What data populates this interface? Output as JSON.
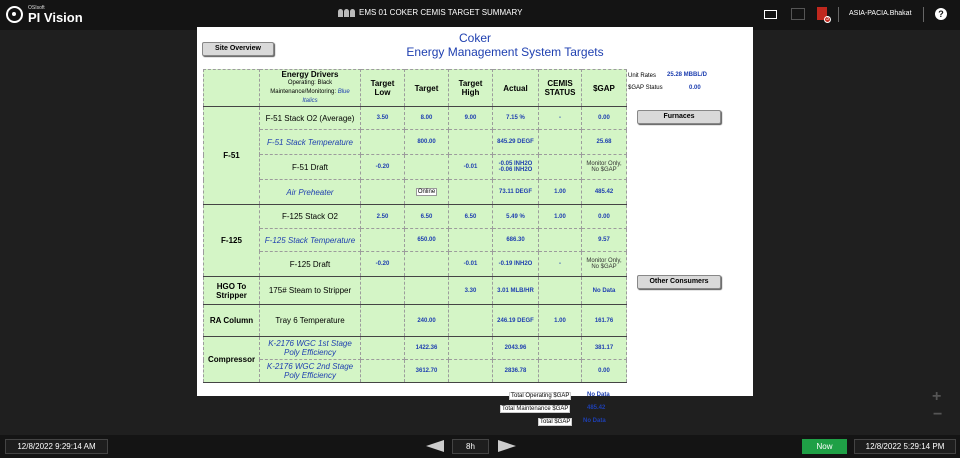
{
  "app": {
    "vendor": "OSIsoft",
    "name": "PI Vision"
  },
  "display": {
    "title": "EMS 01 COKER CEMIS TARGET SUMMARY"
  },
  "user": {
    "name": "ASIA-PACIA.Bhakat",
    "alert_count": "3"
  },
  "header": {
    "line1": "Coker",
    "line2": "Energy Management System Targets"
  },
  "buttons": {
    "site_overview": "Site Overview",
    "furnaces": "Furnaces",
    "other_consumers": "Other Consumers"
  },
  "side_info": {
    "unit_rates_label": "Unit Rates",
    "unit_rates_value": "25.28 MBBL/D",
    "gap_status_label": "$GAP Status",
    "gap_status_value": "0.00"
  },
  "table": {
    "headers": {
      "drivers": "Energy Drivers",
      "drivers_sub1": "Operating: Black",
      "drivers_sub2": "Maintenance/Monitoring:",
      "drivers_sub3": "Blue Italics",
      "target_low": "Target Low",
      "target": "Target",
      "target_high": "Target High",
      "actual": "Actual",
      "cemis": "CEMIS STATUS",
      "gap": "$GAP"
    },
    "groups": [
      {
        "name": "F-51",
        "rows": [
          {
            "driver": "F-51 Stack O2 (Average)",
            "low": "3.50",
            "target": "8.00",
            "high": "9.00",
            "actual": "7.15 %",
            "status": "-",
            "gap": "0.00"
          },
          {
            "driver": "F-51 Stack Temperature",
            "low": "",
            "target": "800.00",
            "high": "",
            "actual": "845.29 DEGF",
            "status": "",
            "gap": "25.68"
          },
          {
            "driver": "F-51 Draft",
            "low": "-0.20",
            "target": "",
            "high": "-0.01",
            "actual": "-0.05 INH2O",
            "actual2": "-0.06 INH2O",
            "status": "",
            "gap": "Monitor Only,",
            "gap2": "No $GAP"
          },
          {
            "driver": "Air Preheater",
            "low": "",
            "target": "Online",
            "high": "",
            "actual": "73.11 DEGF",
            "status": "1.00",
            "gap": "485.42"
          }
        ]
      },
      {
        "name": "F-125",
        "rows": [
          {
            "driver": "F-125 Stack O2",
            "low": "2.50",
            "target": "6.50",
            "high": "6.50",
            "actual": "5.49 %",
            "status": "1.00",
            "gap": "0.00"
          },
          {
            "driver": "F-125 Stack Temperature",
            "low": "",
            "target": "650.00",
            "high": "",
            "actual": "686.30",
            "status": "",
            "gap": "9.57"
          },
          {
            "driver": "F-125 Draft",
            "low": "-0.20",
            "target": "",
            "high": "-0.01",
            "actual": "-0.19 INH2O",
            "status": "-",
            "gap": "Monitor Only,",
            "gap2": "No $GAP"
          }
        ]
      },
      {
        "name": "HGO To",
        "name2": "Stripper",
        "rows": [
          {
            "driver": "175# Steam to Stripper",
            "low": "",
            "target": "",
            "high": "3.30",
            "actual": "3.01 MLB/HR",
            "status": "",
            "gap": "No Data"
          }
        ]
      },
      {
        "name": "RA Column",
        "rows": [
          {
            "driver": "Tray 6 Temperature",
            "low": "",
            "target": "240.00",
            "high": "",
            "actual": "246.19 DEGF",
            "status": "1.00",
            "gap": "161.76"
          }
        ]
      },
      {
        "name": "Compressor",
        "rows": [
          {
            "driver": "K-2176 WGC 1st Stage",
            "driver2": "Poly Efficiency",
            "low": "",
            "target": "1422.36",
            "high": "",
            "actual": "2043.96",
            "status": "",
            "gap": "381.17"
          },
          {
            "driver": "K-2176 WGC 2nd Stage",
            "driver2": "Poly Efficiency",
            "low": "",
            "target": "3612.70",
            "high": "",
            "actual": "2836.78",
            "status": "",
            "gap": "0.00"
          }
        ]
      }
    ]
  },
  "totals": {
    "operating_label": "Total Operating $GAP",
    "operating_value": "No Data",
    "maintenance_label": "Total Maintenance $GAP",
    "maintenance_value": "485.42",
    "total_label": "Total $GAP",
    "total_value": "No Data"
  },
  "timebar": {
    "start": "12/8/2022 9:29:14 AM",
    "duration": "8h",
    "now": "Now",
    "end": "12/8/2022 5:29:14 PM"
  }
}
